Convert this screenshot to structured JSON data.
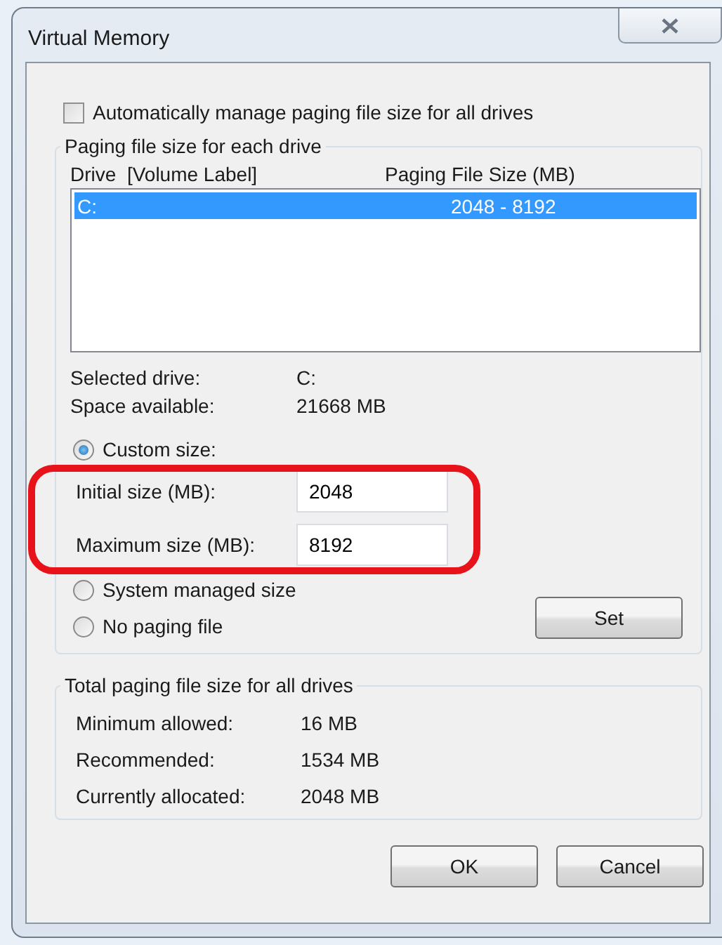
{
  "window": {
    "title": "Virtual Memory"
  },
  "auto_manage": {
    "label": "Automatically manage paging file size for all drives",
    "checked": false
  },
  "drive_group": {
    "title": "Paging file size for each drive",
    "columns": [
      "Drive  [Volume Label]",
      "Paging File Size (MB)"
    ],
    "drives": [
      {
        "drive": "C:",
        "size": "2048 - 8192",
        "selected": true
      }
    ],
    "info": [
      {
        "label": "Selected drive:",
        "value": "C:"
      },
      {
        "label": "Space available:",
        "value": "21668 MB"
      }
    ],
    "options": [
      {
        "label": "Custom size:",
        "selected": true,
        "fields": [
          {
            "label": "Initial size (MB):",
            "value": "2048"
          },
          {
            "label": "Maximum size (MB):",
            "value": "8192"
          }
        ]
      },
      {
        "label": "System managed size",
        "selected": false
      },
      {
        "label": "No paging file",
        "selected": false
      }
    ],
    "set_button": "Set"
  },
  "totals": {
    "title": "Total paging file size for all drives",
    "rows": [
      {
        "label": "Minimum allowed:",
        "value": "16 MB"
      },
      {
        "label": "Recommended:",
        "value": "1534 MB"
      },
      {
        "label": "Currently allocated:",
        "value": "2048 MB"
      }
    ]
  },
  "buttons": [
    "OK",
    "Cancel"
  ]
}
